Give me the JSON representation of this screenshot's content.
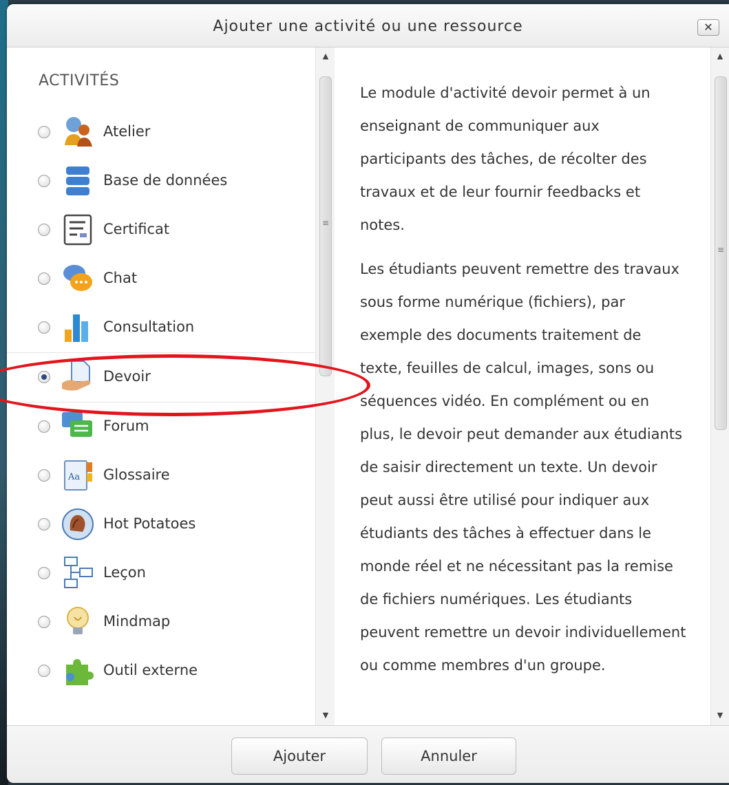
{
  "dialog": {
    "title": "Ajouter une activité ou une ressource",
    "close_label": "✕"
  },
  "activities": {
    "section_title": "ACTIVITÉS",
    "items": [
      {
        "label": "Atelier",
        "icon": "workshop-icon",
        "selected": false
      },
      {
        "label": "Base de données",
        "icon": "database-icon",
        "selected": false
      },
      {
        "label": "Certificat",
        "icon": "certificate-icon",
        "selected": false
      },
      {
        "label": "Chat",
        "icon": "chat-icon",
        "selected": false
      },
      {
        "label": "Consultation",
        "icon": "survey-chart-icon",
        "selected": false
      },
      {
        "label": "Devoir",
        "icon": "assignment-icon",
        "selected": true
      },
      {
        "label": "Forum",
        "icon": "forum-icon",
        "selected": false
      },
      {
        "label": "Glossaire",
        "icon": "glossary-icon",
        "selected": false
      },
      {
        "label": "Hot Potatoes",
        "icon": "hot-potatoes-icon",
        "selected": false
      },
      {
        "label": "Leçon",
        "icon": "lesson-icon",
        "selected": false
      },
      {
        "label": "Mindmap",
        "icon": "lightbulb-icon",
        "selected": false
      },
      {
        "label": "Outil externe",
        "icon": "puzzle-icon",
        "selected": false
      }
    ]
  },
  "description": {
    "paragraphs": [
      "Le module d'activité devoir permet à un enseignant de communiquer aux participants des tâches, de récolter des travaux et de leur fournir feedbacks et notes.",
      "Les étudiants peuvent remettre des travaux sous forme numérique (fichiers), par exemple des documents traitement de texte, feuilles de calcul, images, sons ou séquences vidéo. En complément ou en plus, le devoir peut demander aux étudiants de saisir directement un texte. Un devoir peut aussi être utilisé pour indiquer aux étudiants des tâches à effectuer dans le monde réel et ne nécessitant pas la remise de fichiers numériques. Les étudiants peuvent remettre un devoir individuellement ou comme membres d'un groupe."
    ]
  },
  "footer": {
    "add_label": "Ajouter",
    "cancel_label": "Annuler"
  },
  "colors": {
    "annotation": "#e3141c",
    "radio_checked": "#2e4a7a"
  }
}
